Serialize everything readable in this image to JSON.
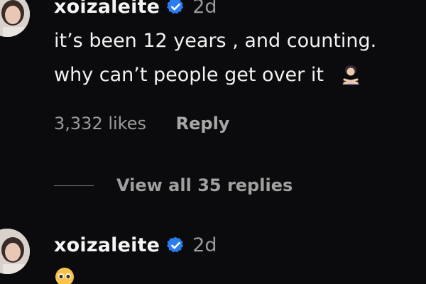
{
  "comments": [
    {
      "username": "xoizaleite",
      "time": "2d",
      "text_lines": [
        "it’s been 12 years , and counting.",
        "why can’t people get over it"
      ],
      "likes": "3,332 likes",
      "reply_label": "Reply",
      "view_replies": "View all 35 replies",
      "icons": [
        "avatar",
        "verified-badge-icon",
        "person-gesturing-no-emoji"
      ]
    },
    {
      "username": "xoizaleite",
      "time": "2d",
      "icons": [
        "avatar",
        "verified-badge-icon",
        "pleading-face-emoji"
      ]
    }
  ],
  "colors": {
    "background": "#0b0b0d",
    "verified": "#2a7df0",
    "muted_text": "#9a9a9a"
  }
}
